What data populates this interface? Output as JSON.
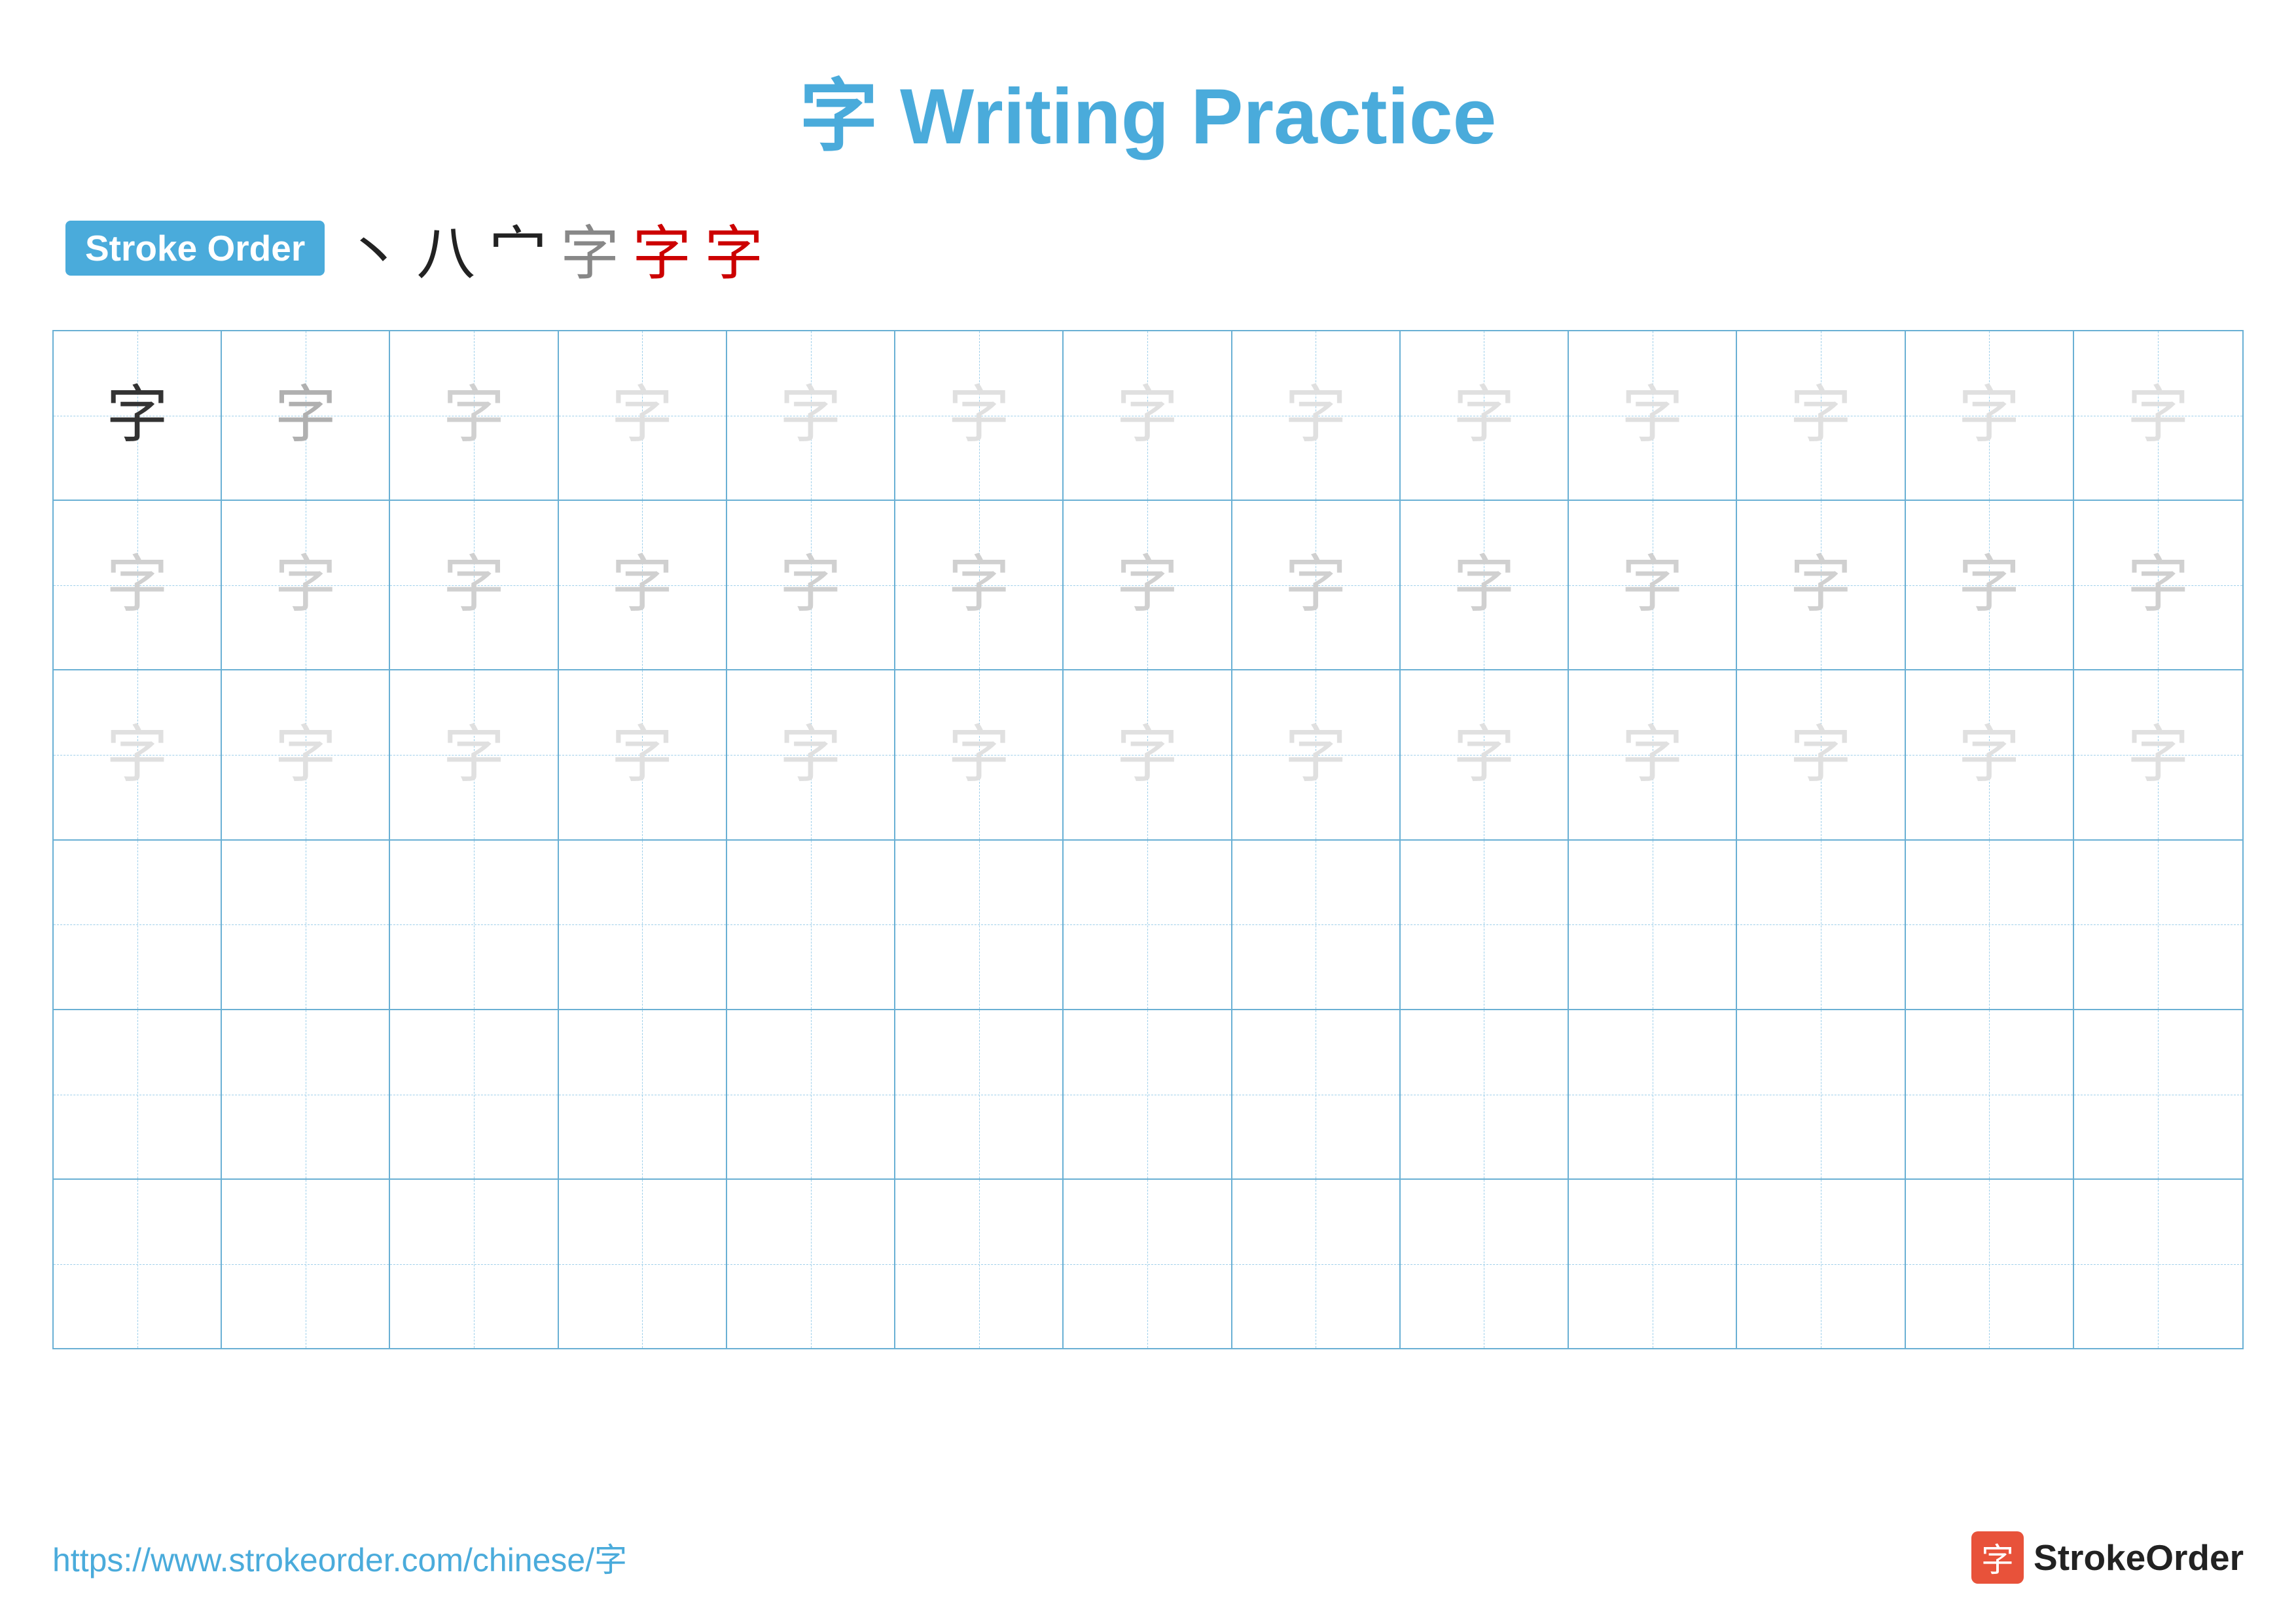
{
  "title": {
    "character": "字",
    "text": "Writing Practice",
    "full": "字 Writing Practice"
  },
  "stroke_order": {
    "badge_label": "Stroke Order",
    "strokes": [
      "丶",
      "ハ",
      "宀",
      "字̶",
      "字̶",
      "字"
    ]
  },
  "grid": {
    "rows": 6,
    "cols": 13,
    "character": "字",
    "row_types": [
      "dark-to-light",
      "medium-light",
      "medium-light",
      "empty",
      "empty",
      "empty"
    ]
  },
  "footer": {
    "url": "https://www.strokeorder.com/chinese/字",
    "logo_char": "字",
    "logo_text": "StrokeOrder"
  },
  "colors": {
    "blue": "#4aabdb",
    "red": "#cc0000",
    "dark_char": "#333333",
    "medium_char": "#b0b0b0",
    "light_char": "#d0d0d0",
    "grid_border": "#6ab0d4",
    "grid_dashed": "#9ecfea"
  }
}
